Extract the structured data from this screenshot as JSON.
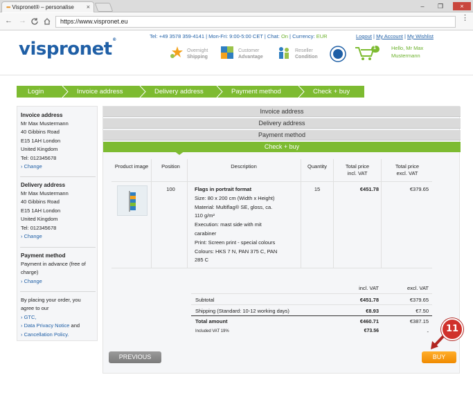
{
  "browser": {
    "tab_title": "Vispronet® – personalise",
    "url": "https://www.vispronet.eu",
    "close_glyph": "×",
    "minimize_glyph": "–",
    "restore_glyph": "❐"
  },
  "header": {
    "logo_text": "vispronet",
    "logo_reg": "®",
    "contact": {
      "tel": "Tel: +49 3578 359-4141",
      "hours": "Mon-Fri: 9:00-5:00 CET",
      "chat_label": "Chat:",
      "chat_status": "On",
      "currency_label": "Currency:",
      "currency_value": "EUR"
    },
    "links": {
      "logout": "Logout",
      "account": "My Account",
      "wishlist": "My Wishlist"
    },
    "usps": [
      {
        "line1": "Overnight",
        "line2": "Shipping"
      },
      {
        "line1": "Customer",
        "line2": "Advantage"
      },
      {
        "line1": "Reseller",
        "line2": "Condition"
      }
    ],
    "cart_count": "1",
    "greeting_line1": "Hello, Mr Max",
    "greeting_line2": "Mustermann"
  },
  "steps": [
    "Login",
    "Invoice address",
    "Delivery address",
    "Payment method",
    "Check + buy"
  ],
  "sidebar": {
    "invoice": {
      "title": "Invoice address",
      "lines": [
        "Mr Max Mustermann",
        "40 Gibbins Road",
        "E15 1AH London",
        "United Kingdom",
        "Tel: 012345678"
      ],
      "change": "› Change"
    },
    "delivery": {
      "title": "Delivery address",
      "lines": [
        "Mr Max Mustermann",
        "40 Gibbins Road",
        "E15 1AH London",
        "United Kingdom",
        "Tel: 012345678"
      ],
      "change": "› Change"
    },
    "payment": {
      "title": "Payment method",
      "line1": "Payment in advance (free of",
      "line2": "charge)",
      "change": "› Change"
    },
    "terms": {
      "line1": "By placing your order, you",
      "line2": "agree to our",
      "gtc": "› GTC,",
      "privacy": "› Data Privacy Notice",
      "and": "and",
      "cancel": "› Cancellation Policy."
    }
  },
  "accordion": [
    "Invoice address",
    "Delivery address",
    "Payment method",
    "Check + buy"
  ],
  "table": {
    "headers": {
      "image": "Product image",
      "position": "Position",
      "description": "Description",
      "quantity": "Quantity",
      "incl_1": "Total price",
      "incl_2": "incl. VAT",
      "excl_1": "Total price",
      "excl_2": "excl. VAT"
    },
    "row": {
      "position": "100",
      "title": "Flags in portrait format",
      "details": [
        "Size: 80 x 200 cm (Width x Height)",
        "Material: Multiflag® SE, gloss, ca.",
        "110 g/m²",
        "Execution: mast side with mit",
        "carabiner",
        "Print: Screen print - special colours",
        "Colours: HKS 7 N, PAN 375 C, PAN",
        "285 C"
      ],
      "quantity": "15",
      "incl": "€451.78",
      "excl": "€379.65"
    }
  },
  "summary": {
    "incl_header": "incl. VAT",
    "excl_header": "excl. VAT",
    "subtotal_label": "Subtotal",
    "subtotal_incl": "€451.78",
    "subtotal_excl": "€379.65",
    "shipping_label": "Shipping (Standard: 10-12 working days)",
    "shipping_incl": "€8.93",
    "shipping_excl": "€7.50",
    "total_label": "Total amount",
    "total_incl": "€460.71",
    "total_excl": "€387.15",
    "vat_label": "Included VAT 19%",
    "vat_incl": "€73.56",
    "vat_excl": "-"
  },
  "buttons": {
    "previous": "PREVIOUS",
    "buy": "BUY"
  },
  "annotation": {
    "badge": "11"
  },
  "colors": {
    "green": "#7dbb31",
    "blue": "#1f5fa6",
    "orange": "#f08a00",
    "badge_red": "#d0312b"
  }
}
